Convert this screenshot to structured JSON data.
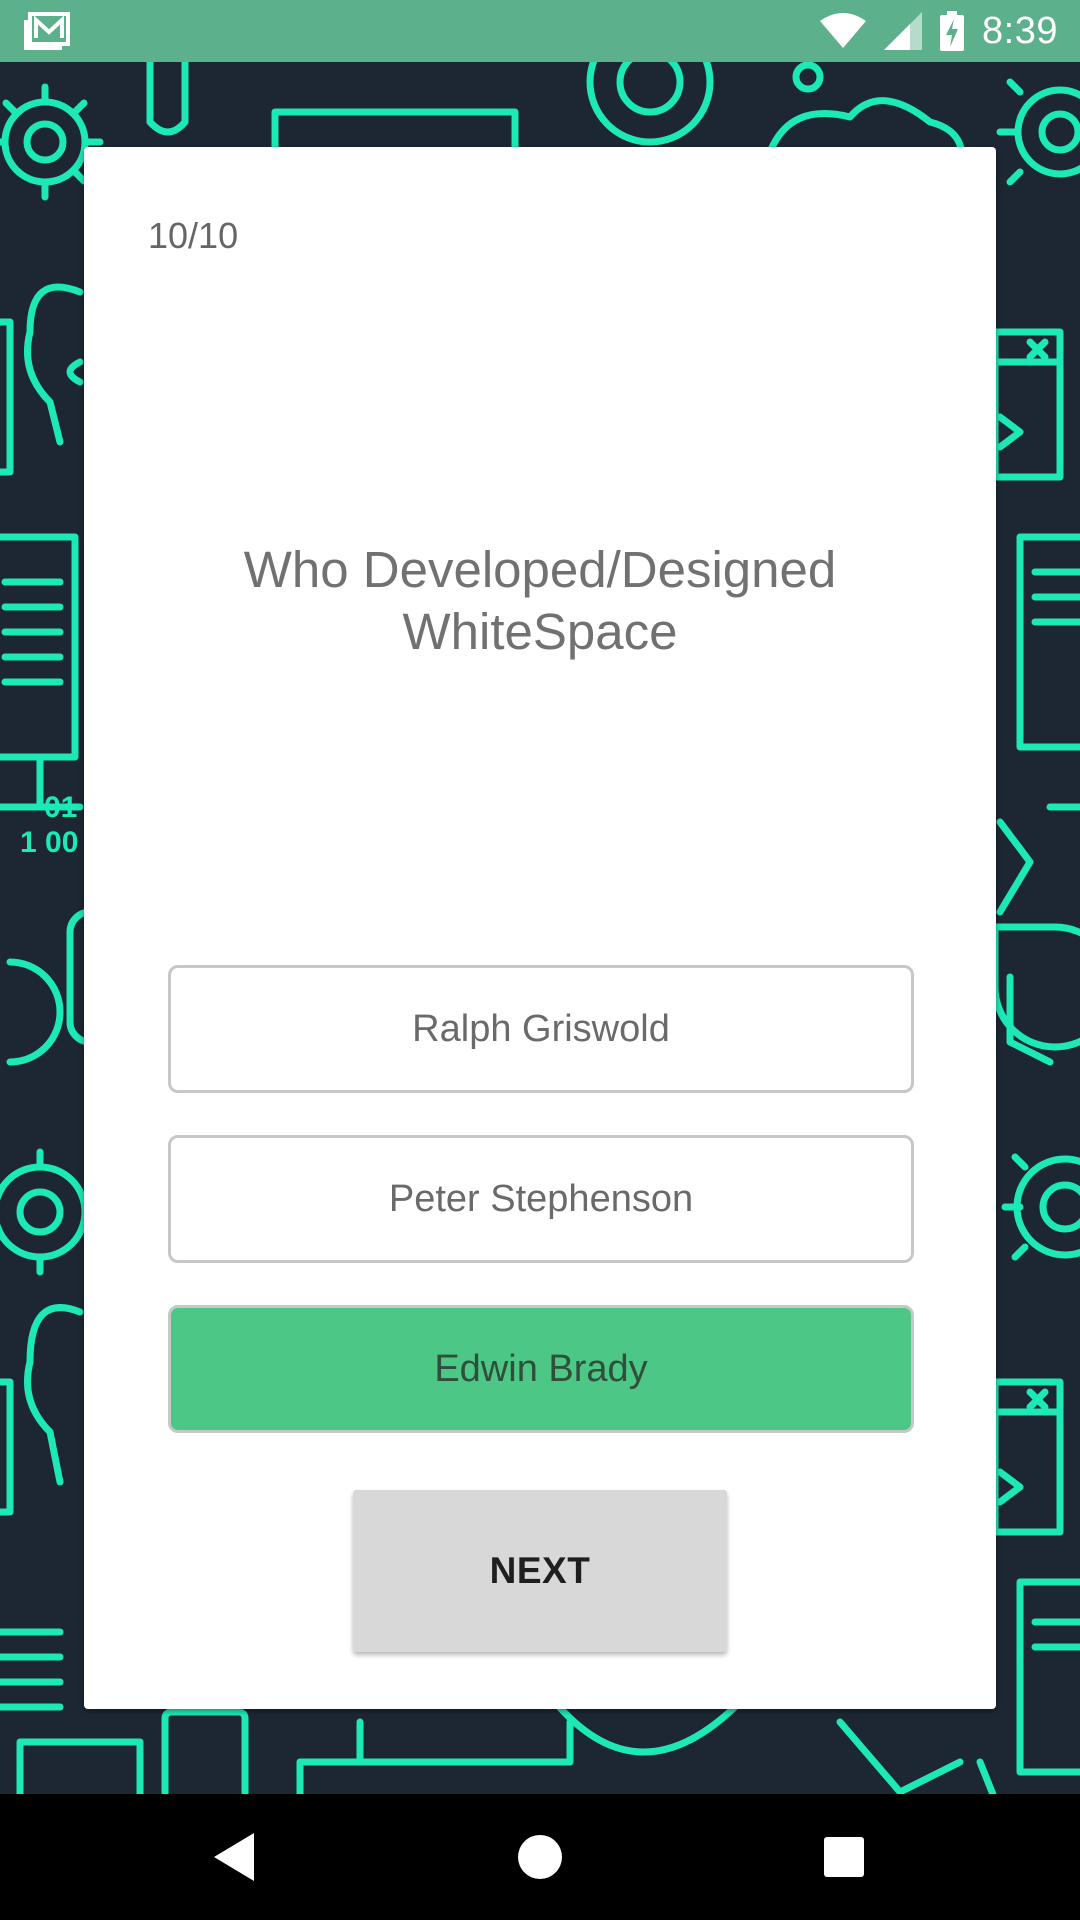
{
  "status_bar": {
    "time": "8:39",
    "left_icon": "gmail-icon",
    "right_icons": [
      "wifi-icon",
      "cell-signal-icon",
      "battery-charging-icon"
    ],
    "color": "#5cb08c"
  },
  "quiz": {
    "progress": "10/10",
    "question": "Who Developed/Designed WhiteSpace",
    "options": [
      {
        "label": "Ralph Griswold",
        "state": "default"
      },
      {
        "label": "Peter Stephenson",
        "state": "default"
      },
      {
        "label": "Edwin Brady",
        "state": "correct"
      }
    ],
    "next_label": "NEXT",
    "correct_color": "#4dc785"
  },
  "background": {
    "pattern_color": "#1de9b6",
    "base_color": "#1c2733",
    "binary_text": "01\n1 00"
  },
  "nav_bar": {
    "buttons": [
      "back-icon",
      "home-icon",
      "recents-icon"
    ]
  }
}
